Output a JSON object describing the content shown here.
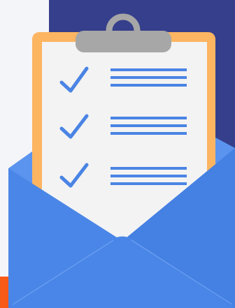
{
  "illustration": {
    "subject": "clipboard-checklist-in-envelope",
    "icons": [
      "clipboard-icon",
      "checkmark-icon",
      "envelope-icon"
    ],
    "checklist_item_count": 3,
    "colors": {
      "page_background": "#f4f5f9",
      "navy_panel": "#363f8b",
      "orange_strip": "#f85a18",
      "clipboard_frame": "#fdb562",
      "clipboard_paper": "#f3f3f3",
      "clip": "#a7a7a7",
      "check_and_lines": "#4a84e4",
      "envelope_front": "#4a86e7",
      "envelope_back": "#5c95ef"
    }
  }
}
